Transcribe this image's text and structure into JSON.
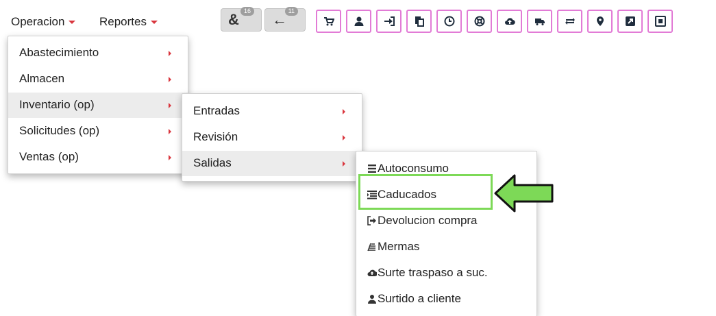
{
  "nav": {
    "operacion_label": "Operacion",
    "reportes_label": "Reportes"
  },
  "history": [
    {
      "icon": "ampersand-icon",
      "glyph": "&",
      "badge": "16"
    },
    {
      "icon": "back-arrow-icon",
      "glyph": "←",
      "badge": "11"
    }
  ],
  "toolbar": {
    "border_color": "#e27bd6",
    "icons": [
      "cart-icon",
      "user-icon",
      "sign-in-icon",
      "copy-icon",
      "clock-icon",
      "life-ring-icon",
      "cloud-upload-icon",
      "truck-icon",
      "exchange-icon",
      "map-marker-icon",
      "external-link-icon",
      "box-icon"
    ]
  },
  "menu_operacion": {
    "items": [
      "Abastecimiento",
      "Almacen",
      "Inventario (op)",
      "Solicitudes (op)",
      "Ventas (op)"
    ]
  },
  "menu_inventario": {
    "items": [
      "Entradas",
      "Revisión",
      "Salidas"
    ]
  },
  "menu_salidas": {
    "items": [
      {
        "icon": "list-icon",
        "label": "Autoconsumo"
      },
      {
        "icon": "list-indent-icon",
        "label": "Caducados"
      },
      {
        "icon": "sign-in-icon",
        "label": "Devolucion compra"
      },
      {
        "icon": "stack-icon",
        "label": "Mermas"
      },
      {
        "icon": "cloud-upload-icon",
        "label": "Surte traspaso a suc."
      },
      {
        "icon": "user-icon",
        "label": "Surtido a cliente"
      }
    ]
  },
  "colors": {
    "caret": "#d9363e",
    "highlight": "#7dd957",
    "active_row": "#ececec"
  }
}
